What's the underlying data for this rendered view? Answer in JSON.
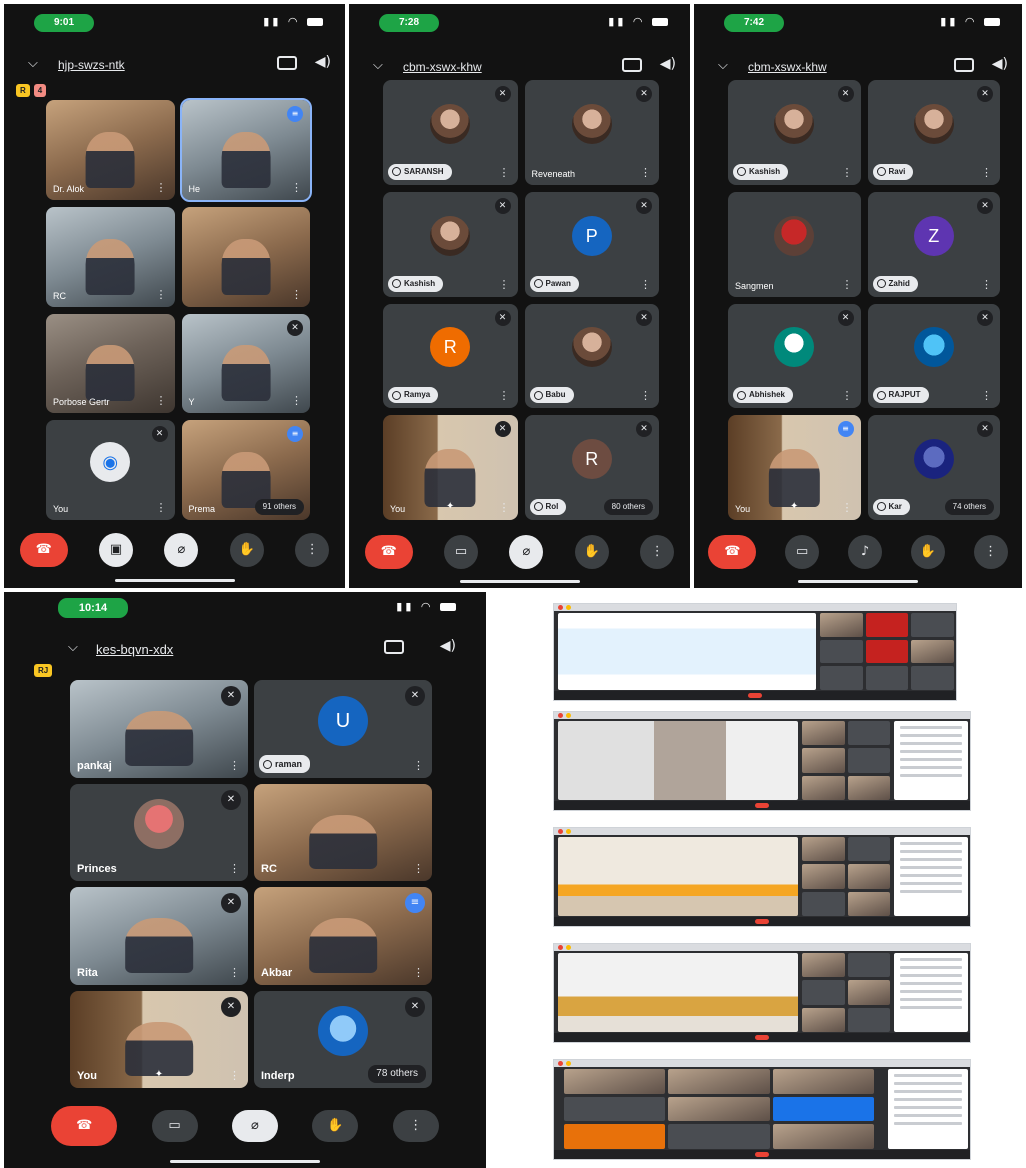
{
  "phones": [
    {
      "time": "9:01",
      "meeting_code": "hjp-swzs-ntk",
      "top_tags": [
        "R",
        "4"
      ],
      "tiles": [
        {
          "name": "Dr. Alok"
        },
        {
          "name": "He"
        },
        {
          "name": "RC"
        },
        {
          "name": ""
        },
        {
          "name": "Porbose Gertr"
        },
        {
          "name": "Y"
        },
        {
          "name": "You"
        },
        {
          "name": "Prema",
          "others": "91 others"
        }
      ]
    },
    {
      "time": "7:28",
      "meeting_code": "cbm-xswx-khw",
      "tiles": [
        {
          "name": "SARANSH"
        },
        {
          "name": "Reveneath"
        },
        {
          "name": "Kashish"
        },
        {
          "name": "Pawan",
          "initial": "P"
        },
        {
          "name": "Ramya",
          "initial": "R"
        },
        {
          "name": "Babu"
        },
        {
          "name": "You"
        },
        {
          "name": "Rol",
          "initial": "R",
          "others": "80 others"
        }
      ]
    },
    {
      "time": "7:42",
      "meeting_code": "cbm-xswx-khw",
      "tiles": [
        {
          "name": "Kashish"
        },
        {
          "name": "Ravi"
        },
        {
          "name": "Sangmen"
        },
        {
          "name": "Zahid",
          "initial": "Z"
        },
        {
          "name": "Abhishek"
        },
        {
          "name": "RAJPUT"
        },
        {
          "name": "You"
        },
        {
          "name": "Kar",
          "others": "74 others"
        }
      ]
    },
    {
      "time": "10:14",
      "meeting_code": "kes-bqvn-xdx",
      "top_tags": [
        "RJ"
      ],
      "tiles": [
        {
          "name": "pankaj"
        },
        {
          "name": "raman",
          "initial": "U"
        },
        {
          "name": "Princes"
        },
        {
          "name": "RC"
        },
        {
          "name": "Rita"
        },
        {
          "name": "Akbar"
        },
        {
          "name": "You"
        },
        {
          "name": "Inderp",
          "others": "78 others"
        }
      ]
    }
  ],
  "controls": {
    "hangup_icon": "phone-hangup-icon",
    "camera_icon": "camera-off-icon",
    "mic_icon": "mic-off-icon",
    "hand_icon": "raise-hand-icon",
    "more_icon": "more-vertical-icon"
  },
  "colors": {
    "meet_bg": "#121212",
    "tile_bg": "#3c4043",
    "hangup_red": "#ea4335",
    "time_pill_green": "#1ea446",
    "speaking_blue": "#4285f4"
  }
}
